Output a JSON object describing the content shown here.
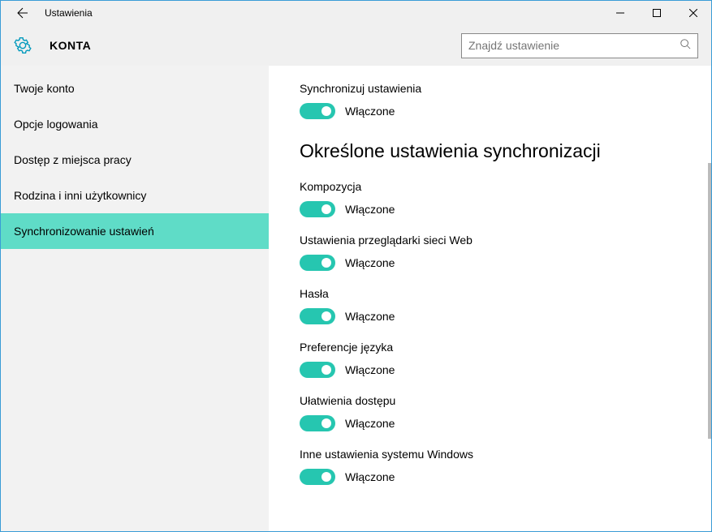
{
  "window": {
    "title": "Ustawienia"
  },
  "header": {
    "title": "KONTA",
    "search_placeholder": "Znajdź ustawienie"
  },
  "sidebar": {
    "items": [
      {
        "label": "Twoje konto",
        "selected": false
      },
      {
        "label": "Opcje logowania",
        "selected": false
      },
      {
        "label": "Dostęp z miejsca pracy",
        "selected": false
      },
      {
        "label": "Rodzina i inni użytkownicy",
        "selected": false
      },
      {
        "label": "Synchronizowanie ustawień",
        "selected": true
      }
    ]
  },
  "content": {
    "main_toggle": {
      "label": "Synchronizuj ustawienia",
      "state": "Włączone"
    },
    "section_heading": "Określone ustawienia synchronizacji",
    "toggles": [
      {
        "label": "Kompozycja",
        "state": "Włączone"
      },
      {
        "label": "Ustawienia przeglądarki sieci Web",
        "state": "Włączone"
      },
      {
        "label": "Hasła",
        "state": "Włączone"
      },
      {
        "label": "Preferencje języka",
        "state": "Włączone"
      },
      {
        "label": "Ułatwienia dostępu",
        "state": "Włączone"
      },
      {
        "label": "Inne ustawienia systemu Windows",
        "state": "Włączone"
      }
    ]
  }
}
